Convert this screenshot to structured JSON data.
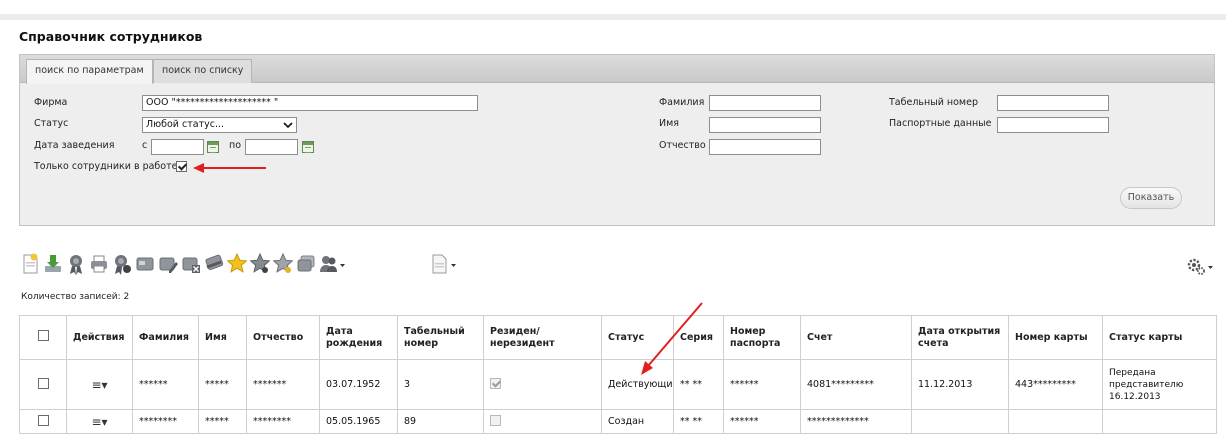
{
  "page_title": "Справочник сотрудников",
  "tabs": [
    {
      "label": "поиск по параметрам",
      "active": true
    },
    {
      "label": "поиск по списку",
      "active": false
    }
  ],
  "filters": {
    "firm_label": "Фирма",
    "firm_value": "ООО \"******************** \"",
    "status_label": "Статус",
    "status_value": "Любой статус...",
    "date_label": "Дата заведения",
    "from_label": "с",
    "to_label": "по",
    "only_working_label": "Только сотрудники в работе",
    "only_working_checked": true,
    "surname_label": "Фамилия",
    "name_label": "Имя",
    "patronymic_label": "Отчество",
    "tab_number_label": "Табельный номер",
    "passport_label": "Паспортные данные",
    "show_button": "Показать"
  },
  "toolbar": {
    "icons": [
      "new-document-icon",
      "download-icon",
      "award-icon",
      "print-icon",
      "award-settings-icon",
      "card-icon",
      "card-edit-icon",
      "card-delete-icon",
      "card-swipe-icon",
      "star-icon",
      "star-grey-icon",
      "star-outline-icon",
      "card-copy-icon",
      "people-menu-icon",
      "document-menu-icon"
    ],
    "settings_icon": "gear-icon"
  },
  "records_count": "Количество записей: 2",
  "table": {
    "columns": [
      "",
      "Действия",
      "Фамилия",
      "Имя",
      "Отчество",
      "Дата рождения",
      "Табельный номер",
      "Резиден/нерезидент",
      "Статус",
      "Серия",
      "Номер паспорта",
      "Счет",
      "Дата открытия счета",
      "Номер карты",
      "Статус карты"
    ],
    "rows": [
      {
        "surname": "******",
        "name": "*****",
        "patronymic": "*******",
        "birth_date": "03.07.1952",
        "tab_number": "3",
        "resident_checked": true,
        "status": "Действующий",
        "series": "** **",
        "passport_number": "******",
        "account": "4081*********",
        "account_open_date": "11.12.2013",
        "card_number": "443*********",
        "card_status": "Передана представителю 16.12.2013"
      },
      {
        "surname": "********",
        "name": "*****",
        "patronymic": "********",
        "birth_date": "05.05.1965",
        "tab_number": "89",
        "resident_checked": false,
        "status": "Создан",
        "series": "** **",
        "passport_number": "******",
        "account": "*************",
        "account_open_date": "",
        "card_number": "",
        "card_status": ""
      }
    ]
  },
  "colors": {
    "annotation_arrow": "#e02020",
    "panel_bg": "#eeeeee",
    "border": "#cfcfcf"
  }
}
